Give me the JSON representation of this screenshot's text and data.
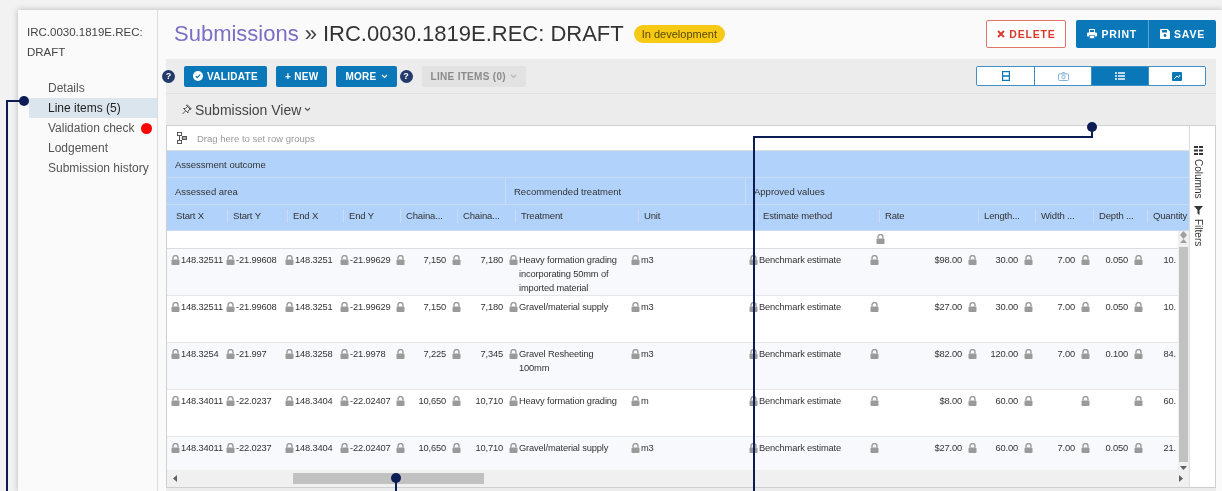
{
  "sidebar": {
    "title": "IRC.0030.1819E.REC: DRAFT",
    "items": [
      {
        "label": "Details",
        "selected": false
      },
      {
        "label": "Line items (5)",
        "selected": true
      },
      {
        "label": "Validation check",
        "selected": false,
        "color": "#ff0000"
      },
      {
        "label": "Lodgement",
        "selected": false
      },
      {
        "label": "Submission history",
        "selected": false
      }
    ]
  },
  "header": {
    "breadcrumb": "Submissions",
    "separator": "»",
    "title": "IRC.0030.1819E.REC: DRAFT",
    "status": "In development",
    "buttons": [
      {
        "kind": "delete",
        "label": "DELETE"
      },
      {
        "kind": "print",
        "label": "PRINT"
      },
      {
        "kind": "save",
        "label": "SAVE"
      }
    ]
  },
  "toolbar": {
    "actions": [
      {
        "kind": "help",
        "label": "?"
      },
      {
        "kind": "check",
        "label": "VALIDATE",
        "disabled": false
      },
      {
        "kind": "plain",
        "label": "+ NEW",
        "disabled": false
      },
      {
        "kind": "menu",
        "label": "MORE",
        "disabled": false
      },
      {
        "kind": "help",
        "label": "?"
      },
      {
        "kind": "menu",
        "label": "LINE ITEMS (0)",
        "disabled": true
      }
    ],
    "views": [
      {
        "kind": "form",
        "selected": false
      },
      {
        "kind": "camera",
        "selected": false
      },
      {
        "kind": "list",
        "selected": true
      },
      {
        "kind": "image",
        "selected": false
      }
    ]
  },
  "view_menu": {
    "label": "Submission View"
  },
  "grid": {
    "group_hint": "Drag here to set row groups",
    "side_panels": [
      "Columns",
      "Filters"
    ],
    "column_groups": [
      {
        "label": "Assessment outcome",
        "groups": [
          {
            "label": "Assessed area",
            "columns": [
              {
                "label": "Start X",
                "kind": "text",
                "filter_locked": false
              },
              {
                "label": "Start Y",
                "kind": "text",
                "filter_locked": false
              },
              {
                "label": "End X",
                "kind": "text",
                "filter_locked": false
              },
              {
                "label": "End Y",
                "kind": "text",
                "filter_locked": false
              },
              {
                "label": "Chaina...",
                "kind": "number",
                "filter_locked": false
              },
              {
                "label": "Chaina...",
                "kind": "number",
                "filter_locked": false
              }
            ]
          },
          {
            "label": "Recommended treatment",
            "columns": [
              {
                "label": "Treatment",
                "kind": "text",
                "filter_locked": false
              },
              {
                "label": "Unit",
                "kind": "text",
                "filter_locked": false
              }
            ]
          },
          {
            "label": "Approved values",
            "columns": [
              {
                "label": "Estimate method",
                "kind": "text",
                "filter_locked": false
              },
              {
                "label": "Rate",
                "kind": "number",
                "filter_locked": true
              },
              {
                "label": "Length...",
                "kind": "number",
                "filter_locked": false
              },
              {
                "label": "Width ...",
                "kind": "number",
                "filter_locked": false
              },
              {
                "label": "Depth ...",
                "kind": "number",
                "filter_locked": false
              },
              {
                "label": "Quantity",
                "kind": "number",
                "filter_locked": false
              }
            ]
          }
        ]
      }
    ],
    "rows": [
      [
        "148.32511",
        "-21.99608",
        "148.3251",
        "-21.99629",
        "7,150",
        "7,180",
        "Heavy formation grading incorporating 50mm of imported material",
        "m3",
        "Benchmark estimate",
        "$98.00",
        "30.00",
        "7.00",
        "0.050",
        "10."
      ],
      [
        "148.32511",
        "-21.99608",
        "148.3251",
        "-21.99629",
        "7,150",
        "7,180",
        "Gravel/material supply",
        "m3",
        "Benchmark estimate",
        "$27.00",
        "30.00",
        "7.00",
        "0.050",
        "10."
      ],
      [
        "148.3254",
        "-21.997",
        "148.3258",
        "-21.9978",
        "7,225",
        "7,345",
        "Gravel Resheeting 100mm",
        "m3",
        "Benchmark estimate",
        "$82.00",
        "120.00",
        "7.00",
        "0.100",
        "84."
      ],
      [
        "148.34011",
        "-22.0237",
        "148.3404",
        "-22.02407",
        "10,650",
        "10,710",
        "Heavy formation grading",
        "m",
        "Benchmark estimate",
        "$8.00",
        "60.00",
        null,
        null,
        "60."
      ],
      [
        "148.34011",
        "-22.0237",
        "148.3404",
        "-22.02407",
        "10,650",
        "10,710",
        "Gravel/material supply",
        "m3",
        "Benchmark estimate",
        "$27.00",
        "60.00",
        "7.00",
        "0.050",
        "21."
      ]
    ]
  }
}
